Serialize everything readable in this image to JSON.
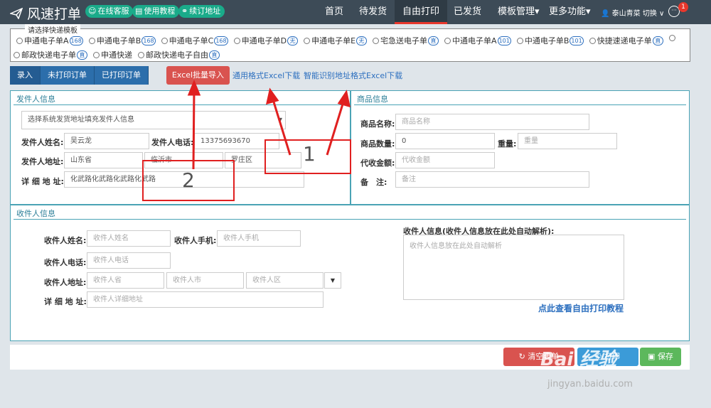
{
  "app": {
    "title": "风速打单"
  },
  "header_tags": {
    "online_service": "在线客服",
    "tutorial": "使用教程",
    "renew_address": "续订地址"
  },
  "nav": {
    "items": [
      "首页",
      "待发货",
      "自由打印",
      "已发货",
      "模板管理▾",
      "更多功能▾"
    ],
    "active_index": 2
  },
  "user": {
    "name": "泰山青菜",
    "switch_label": "切换 ∨",
    "unread_count": "1"
  },
  "templates": {
    "legend": "请选择快递模板",
    "row1": [
      {
        "name": "申通电子单A",
        "badge": "168"
      },
      {
        "name": "申通电子单B",
        "badge": "168"
      },
      {
        "name": "申通电子单C",
        "badge": "168"
      },
      {
        "name": "申通电子单D",
        "badge": "无"
      },
      {
        "name": "申通电子单E",
        "badge": "无"
      },
      {
        "name": "宅急送电子单",
        "badge": "直"
      },
      {
        "name": "中通电子单A",
        "badge": "101"
      },
      {
        "name": "中通电子单B",
        "badge": "101"
      },
      {
        "name": "快捷速递电子单",
        "badge": "直"
      }
    ],
    "row2": [
      {
        "name": "邮政快递电子单",
        "badge": "直"
      },
      {
        "name": "申通快递",
        "badge": ""
      },
      {
        "name": "邮政快递电子自由",
        "badge": "直"
      }
    ]
  },
  "tabs": [
    "录入",
    "未打印订单",
    "已打印订单"
  ],
  "actions": {
    "excel_import": "Excel批量导入",
    "general_excel_download": "通用格式Excel下载",
    "smart_excel_download": "智能识别地址格式Excel下载"
  },
  "sender": {
    "title": "发件人信息",
    "select_placeholder": "选择系统发货地址填充发件人信息",
    "name_label": "发件人姓名:",
    "name": "吴云龙",
    "phone_label": "发件人电话:",
    "phone": "13375693670",
    "address_label": "发件人地址:",
    "province": "山东省",
    "city": "临沂市",
    "district": "罗庄区",
    "detail_label": "详 细 地 址:",
    "detail": "化武路化武路化武路化武路"
  },
  "goods": {
    "title": "商品信息",
    "name_label": "商品名称:",
    "name_placeholder": "商品名称",
    "qty_label": "商品数量:",
    "qty": "0",
    "weight_label": "重量:",
    "weight_placeholder": "重量",
    "cod_label": "代收金额:",
    "cod_placeholder": "代收金额",
    "note_label": "备　注:",
    "note_placeholder": "备注"
  },
  "receiver": {
    "title": "收件人信息",
    "name_label": "收件人姓名:",
    "name_placeholder": "收件人姓名",
    "mobile_label": "收件人手机:",
    "mobile_placeholder": "收件人手机",
    "phone_label": "收件人电话:",
    "phone_placeholder": "收件人电话",
    "address_label": "收件人地址:",
    "province_placeholder": "收件人省",
    "city_placeholder": "收件人市",
    "district_placeholder": "收件人区",
    "detail_label": "详 细 地 址:",
    "detail_placeholder": "收件人详细地址",
    "parse_label": "收件人信息(收件人信息放在此处自动解析):",
    "parse_placeholder": "收件人信息放在此处自动解析",
    "tutorial_link": "点此查看自由打印教程"
  },
  "bottom": {
    "clear_label": "清空表单",
    "print_label": "打印",
    "save_label": "保存"
  },
  "annotations": {
    "num1": "1",
    "num2": "2"
  },
  "watermark": {
    "main": "Bai 经验",
    "sub": "jingyan.baidu.com"
  },
  "colors": {
    "nav_bg": "#3d4b57",
    "accent_red": "#d9534f",
    "primary_blue": "#2c6eab",
    "teal": "#1aab8a",
    "panel_border": "#4aa3b5",
    "annotation_red": "#e02020"
  }
}
